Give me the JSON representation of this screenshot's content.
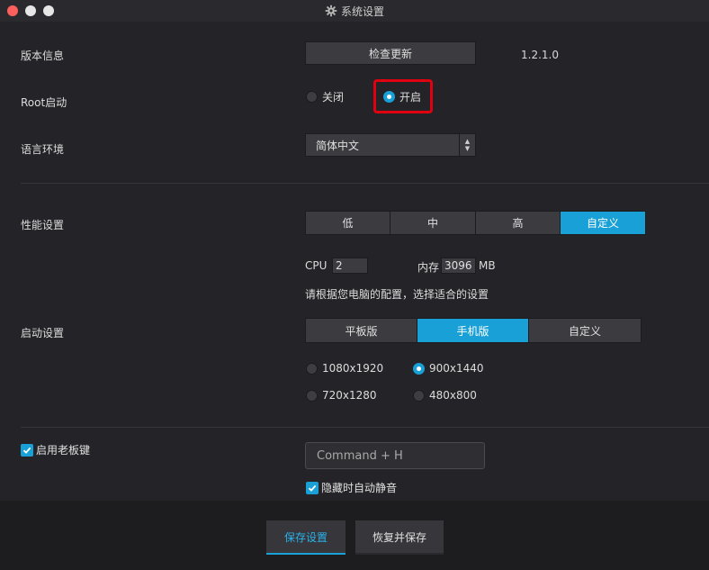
{
  "window": {
    "title": "系统设置",
    "icon": "gear-icon"
  },
  "version": {
    "label": "版本信息",
    "check_button": "检查更新",
    "value": "1.2.1.0"
  },
  "root": {
    "label": "Root启动",
    "options": [
      "关闭",
      "开启"
    ],
    "selected": "开启"
  },
  "language": {
    "label": "语言环境",
    "value": "简体中文"
  },
  "performance": {
    "label": "性能设置",
    "options": [
      "低",
      "中",
      "高",
      "自定义"
    ],
    "selected": "自定义",
    "cpu_label": "CPU",
    "cpu_value": "2",
    "memory_label": "内存",
    "memory_value": "3096",
    "memory_unit": "MB",
    "hint": "请根据您电脑的配置，选择适合的设置"
  },
  "startup": {
    "label": "启动设置",
    "options": [
      "平板版",
      "手机版",
      "自定义"
    ],
    "selected": "手机版",
    "resolutions": [
      "1080x1920",
      "900x1440",
      "720x1280",
      "480x800"
    ],
    "selected_resolution": "900x1440"
  },
  "boss_key": {
    "label": "启用老板键",
    "checked": true,
    "hotkey": "Command + H",
    "mute_label": "隐藏时自动静音",
    "mute_checked": true
  },
  "footer": {
    "save": "保存设置",
    "restore_save": "恢复并保存"
  },
  "colors": {
    "accent": "#19a0d6",
    "highlight": "#e00010",
    "background": "#242428"
  }
}
